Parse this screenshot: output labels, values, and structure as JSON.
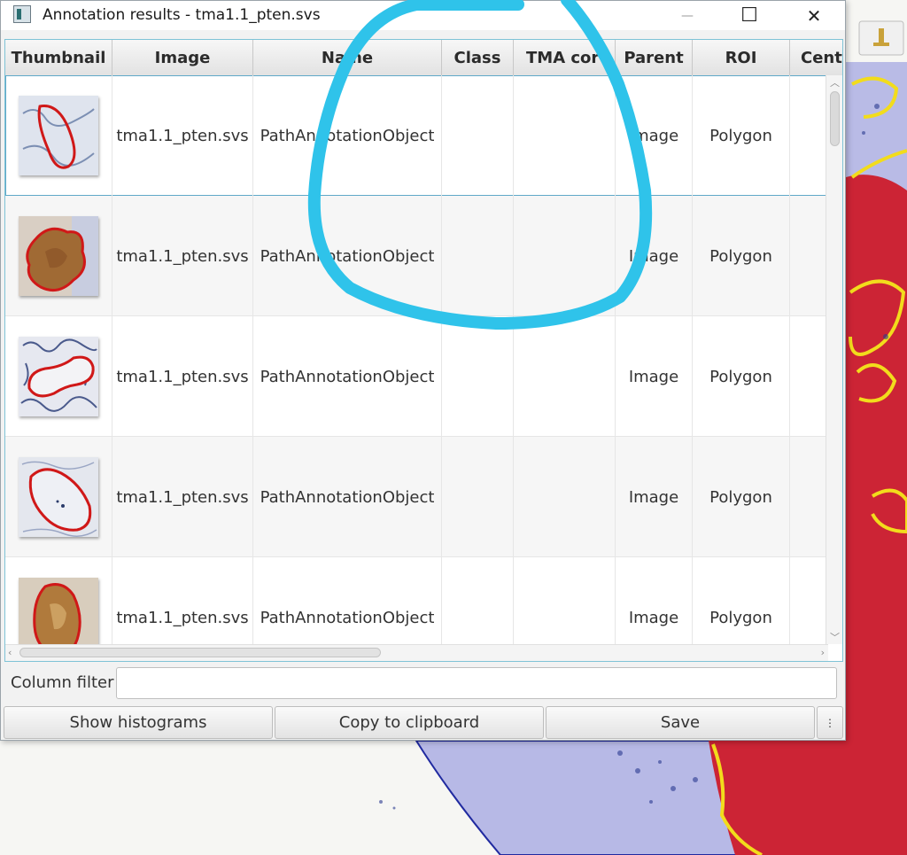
{
  "window": {
    "title": "Annotation results - tma1.1_pten.svs",
    "minimize_symbol": "—",
    "maximize_symbol": "☐",
    "close_symbol": "✕"
  },
  "table": {
    "columns": [
      "Thumbnail",
      "Image",
      "Name",
      "Class",
      "TMA cor",
      "Parent",
      "ROI",
      "Centr"
    ],
    "rows": [
      {
        "image": "tma1.1_pten.svs",
        "name": "PathAnnotationObject",
        "class": "",
        "tma": "",
        "parent": "Image",
        "roi": "Polygon",
        "thumb": "light-oval"
      },
      {
        "image": "tma1.1_pten.svs",
        "name": "PathAnnotationObject",
        "class": "",
        "tma": "",
        "parent": "Image",
        "roi": "Polygon",
        "thumb": "brown-blob"
      },
      {
        "image": "tma1.1_pten.svs",
        "name": "PathAnnotationObject",
        "class": "",
        "tma": "",
        "parent": "Image",
        "roi": "Polygon",
        "thumb": "blue-kidney"
      },
      {
        "image": "tma1.1_pten.svs",
        "name": "PathAnnotationObject",
        "class": "",
        "tma": "",
        "parent": "Image",
        "roi": "Polygon",
        "thumb": "pale-ellipse"
      },
      {
        "image": "tma1.1_pten.svs",
        "name": "PathAnnotationObject",
        "class": "",
        "tma": "",
        "parent": "Image",
        "roi": "Polygon",
        "thumb": "brown-ellipse"
      }
    ]
  },
  "filter": {
    "label": "Column filter",
    "value": ""
  },
  "buttons": {
    "histograms": "Show histograms",
    "copy": "Copy to clipboard",
    "save": "Save",
    "more": "⋮"
  },
  "colors": {
    "annotation_outline": "#d01818",
    "highlight_stroke": "#2fc3ea",
    "tissue_yellow": "#f2dc1c",
    "selection_border": "#5fa9c8"
  }
}
